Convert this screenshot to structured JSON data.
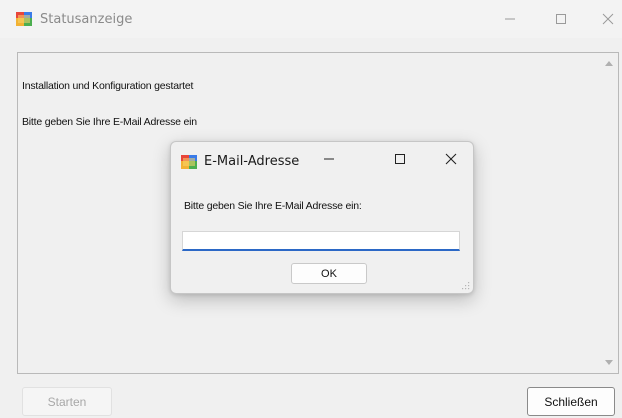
{
  "main_window": {
    "title": "Statusanzeige",
    "log_lines": [
      "Installation und Konfiguration gestartet",
      "Bitte geben Sie Ihre E-Mail Adresse ein"
    ],
    "buttons": {
      "start": "Starten",
      "close": "Schließen"
    }
  },
  "dialog": {
    "title": "E-Mail-Adresse",
    "prompt": "Bitte geben Sie Ihre E-Mail Adresse ein:",
    "input_value": "",
    "ok_label": "OK"
  },
  "icons": {
    "app": "app-window-icon",
    "minimize": "minimize-icon",
    "maximize": "maximize-icon",
    "close": "close-icon",
    "scroll_up": "scroll-up-arrow-icon",
    "scroll_down": "scroll-down-arrow-icon",
    "resize": "resize-grip-icon"
  },
  "colors": {
    "accent": "#2b68c6",
    "disabled_text": "#a8a8a8"
  }
}
